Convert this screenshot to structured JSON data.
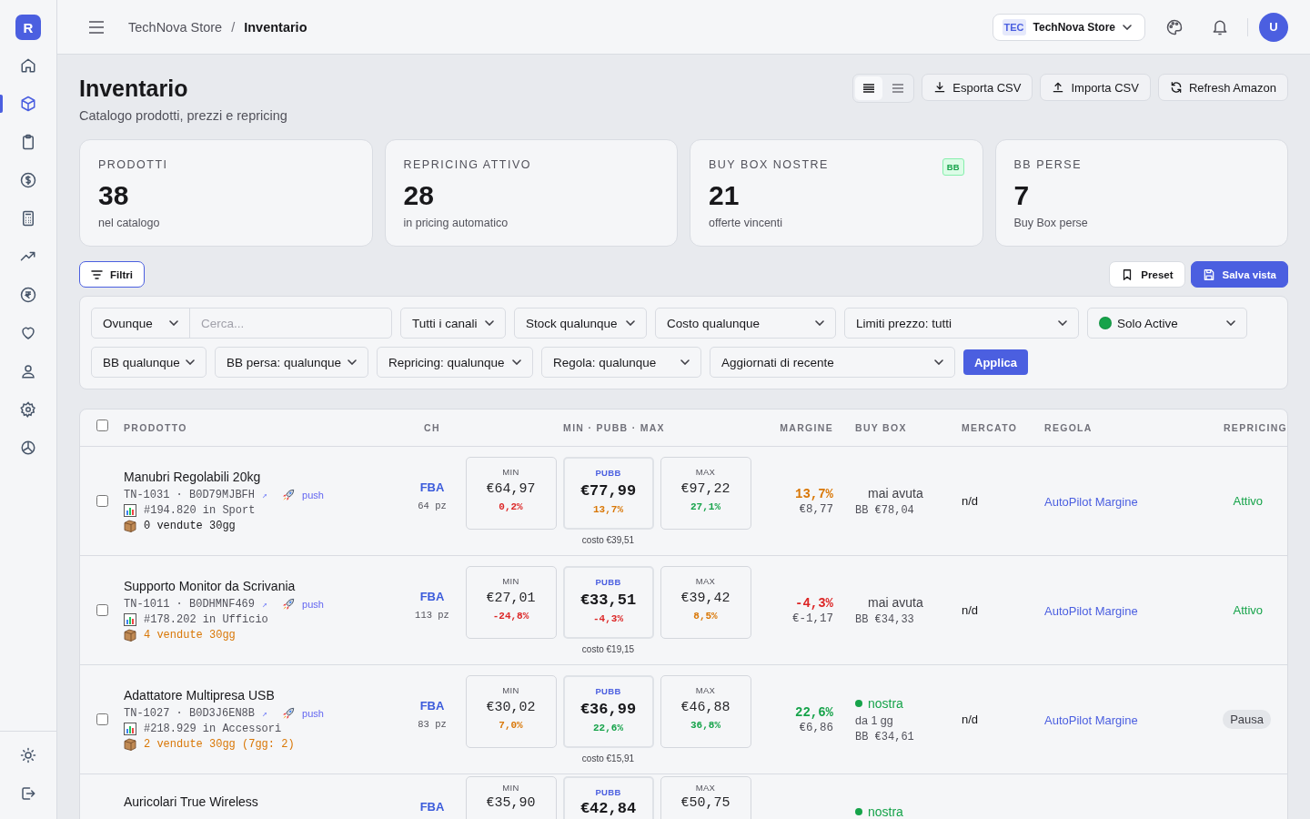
{
  "sidebar": {
    "logo": "R",
    "items": [
      {
        "selected": false
      },
      {
        "selected": true
      },
      {
        "selected": false
      },
      {
        "selected": false
      },
      {
        "selected": false
      },
      {
        "selected": false
      },
      {
        "selected": false
      },
      {
        "selected": false
      },
      {
        "selected": false
      },
      {
        "selected": false
      },
      {
        "selected": false
      }
    ],
    "footer": [
      {
        "selected": false
      },
      {
        "selected": false
      }
    ]
  },
  "topbar": {
    "breadcrumb": [
      "TechNova Store",
      "Inventario"
    ],
    "separator": "/",
    "store": {
      "code": "TEC",
      "name": "TechNova Store"
    },
    "avatar": "U"
  },
  "page": {
    "title": "Inventario",
    "subtitle": "Catalogo prodotti, prezzi e repricing"
  },
  "view_modes": [
    {
      "selected": true
    },
    {
      "selected": false
    }
  ],
  "actions": [
    {
      "kind": "download",
      "label": "Esporta CSV"
    },
    {
      "kind": "upload",
      "label": "Importa CSV"
    },
    {
      "kind": "refresh",
      "label": "Refresh Amazon"
    }
  ],
  "stats": [
    {
      "label": "PRODOTTI",
      "value": "38",
      "sub": "nel catalogo"
    },
    {
      "label": "REPRICING ATTIVO",
      "value": "28",
      "sub": "in pricing automatico"
    },
    {
      "label": "BUY BOX NOSTRE",
      "value": "21",
      "sub": "offerte vincenti",
      "badge": "BB"
    },
    {
      "label": "BB PERSE",
      "value": "7",
      "sub": "Buy Box perse"
    }
  ],
  "filter_button": "Filtri",
  "view_buttons": [
    {
      "kind": "preset",
      "label": "Preset"
    },
    {
      "kind": "save",
      "label": "Salva vista"
    }
  ],
  "filters": [
    {
      "kind": "scope_search",
      "label": "Ovunque",
      "placeholder": "Cerca..."
    },
    {
      "kind": "select",
      "label": "Tutti i canali"
    },
    {
      "kind": "select",
      "label": "Stock qualunque"
    },
    {
      "kind": "select",
      "label": "Costo qualunque"
    },
    {
      "kind": "select",
      "label": "Limiti prezzo: tutti"
    },
    {
      "kind": "select",
      "label": "Solo Active",
      "color": "#16a34a"
    },
    {
      "kind": "select",
      "label": "BB qualunque"
    },
    {
      "kind": "select",
      "label": "BB persa: qualunque"
    },
    {
      "kind": "select",
      "label": "Repricing: qualunque"
    },
    {
      "kind": "select",
      "label": "Regola: qualunque"
    },
    {
      "kind": "select",
      "label": "Aggiornati di recente"
    },
    {
      "kind": "apply",
      "label": "Applica"
    }
  ],
  "table": {
    "columns": [
      "PRODOTTO",
      "CH",
      "MIN · PUBB · MAX",
      "MARGINE",
      "BUY BOX",
      "MERCATO",
      "REGOLA",
      "REPRICING"
    ],
    "select_all": false,
    "rows": [
      {
        "selected": false,
        "name": "Manubri Regolabili 20kg",
        "sku": "TN-1031 · B0D79MJBFH",
        "link": "↗",
        "push": "push",
        "rank": "#194.820 in Sport",
        "sales": {
          "text": "0 vendute 30gg",
          "color": "#18181b"
        },
        "channel": "FBA",
        "stock": "64 pz",
        "min": {
          "label": "MIN",
          "price": "€64,97",
          "pct": "0,2%",
          "color": "#dc2626"
        },
        "pubb": {
          "label": "PUBB",
          "price": "€77,99",
          "pct": "13,7%",
          "color": "#d97706"
        },
        "max": {
          "label": "MAX",
          "price": "€97,22",
          "pct": "27,1%",
          "color": "#16a34a"
        },
        "cost": "costo €39,51",
        "margin": {
          "pct": "13,7%",
          "color": "#d97706",
          "amount": "€8,77"
        },
        "buybox": {
          "ours": false,
          "status": "mai avuta",
          "price": "BB €78,04"
        },
        "market": "n/d",
        "rule": "AutoPilot Margine",
        "repricing": {
          "kind": "active",
          "label": "Attivo"
        }
      },
      {
        "selected": false,
        "name": "Supporto Monitor da Scrivania",
        "sku": "TN-1011 · B0DHMNF469",
        "link": "↗",
        "push": "push",
        "rank": "#178.202 in Ufficio",
        "sales": {
          "text": "4 vendute 30gg",
          "color": "#d97706"
        },
        "channel": "FBA",
        "stock": "113 pz",
        "min": {
          "label": "MIN",
          "price": "€27,01",
          "pct": "-24,8%",
          "color": "#dc2626"
        },
        "pubb": {
          "label": "PUBB",
          "price": "€33,51",
          "pct": "-4,3%",
          "color": "#dc2626"
        },
        "max": {
          "label": "MAX",
          "price": "€39,42",
          "pct": "8,5%",
          "color": "#d97706"
        },
        "cost": "costo €19,15",
        "margin": {
          "pct": "-4,3%",
          "color": "#dc2626",
          "amount": "€-1,17"
        },
        "buybox": {
          "ours": false,
          "status": "mai avuta",
          "price": "BB €34,33"
        },
        "market": "n/d",
        "rule": "AutoPilot Margine",
        "repricing": {
          "kind": "active",
          "label": "Attivo"
        }
      },
      {
        "selected": false,
        "name": "Adattatore Multipresa USB",
        "sku": "TN-1027 · B0D3J6EN8B",
        "link": "↗",
        "push": "push",
        "rank": "#218.929 in Accessori",
        "sales": {
          "text": "2 vendute 30gg (7gg: 2)",
          "color": "#d97706"
        },
        "channel": "FBA",
        "stock": "83 pz",
        "min": {
          "label": "MIN",
          "price": "€30,02",
          "pct": "7,0%",
          "color": "#d97706"
        },
        "pubb": {
          "label": "PUBB",
          "price": "€36,99",
          "pct": "22,6%",
          "color": "#16a34a"
        },
        "max": {
          "label": "MAX",
          "price": "€46,88",
          "pct": "36,8%",
          "color": "#16a34a"
        },
        "cost": "costo €15,91",
        "margin": {
          "pct": "22,6%",
          "color": "#16a34a",
          "amount": "€6,86"
        },
        "buybox": {
          "ours": true,
          "status": "nostra",
          "since": "da 1 gg",
          "price": "BB €34,61"
        },
        "market": "n/d",
        "rule": "AutoPilot Margine",
        "repricing": {
          "kind": "paused",
          "label": "Pausa"
        }
      },
      {
        "name": "Auricolari True Wireless",
        "channel": "FBA",
        "min": {
          "label": "MIN",
          "price": "€35,90"
        },
        "pubb": {
          "label": "PUBB",
          "price": "€42,84"
        },
        "max": {
          "label": "MAX",
          "price": "€50,75"
        },
        "buybox": {
          "ours": true,
          "status": "nostra"
        }
      }
    ]
  }
}
